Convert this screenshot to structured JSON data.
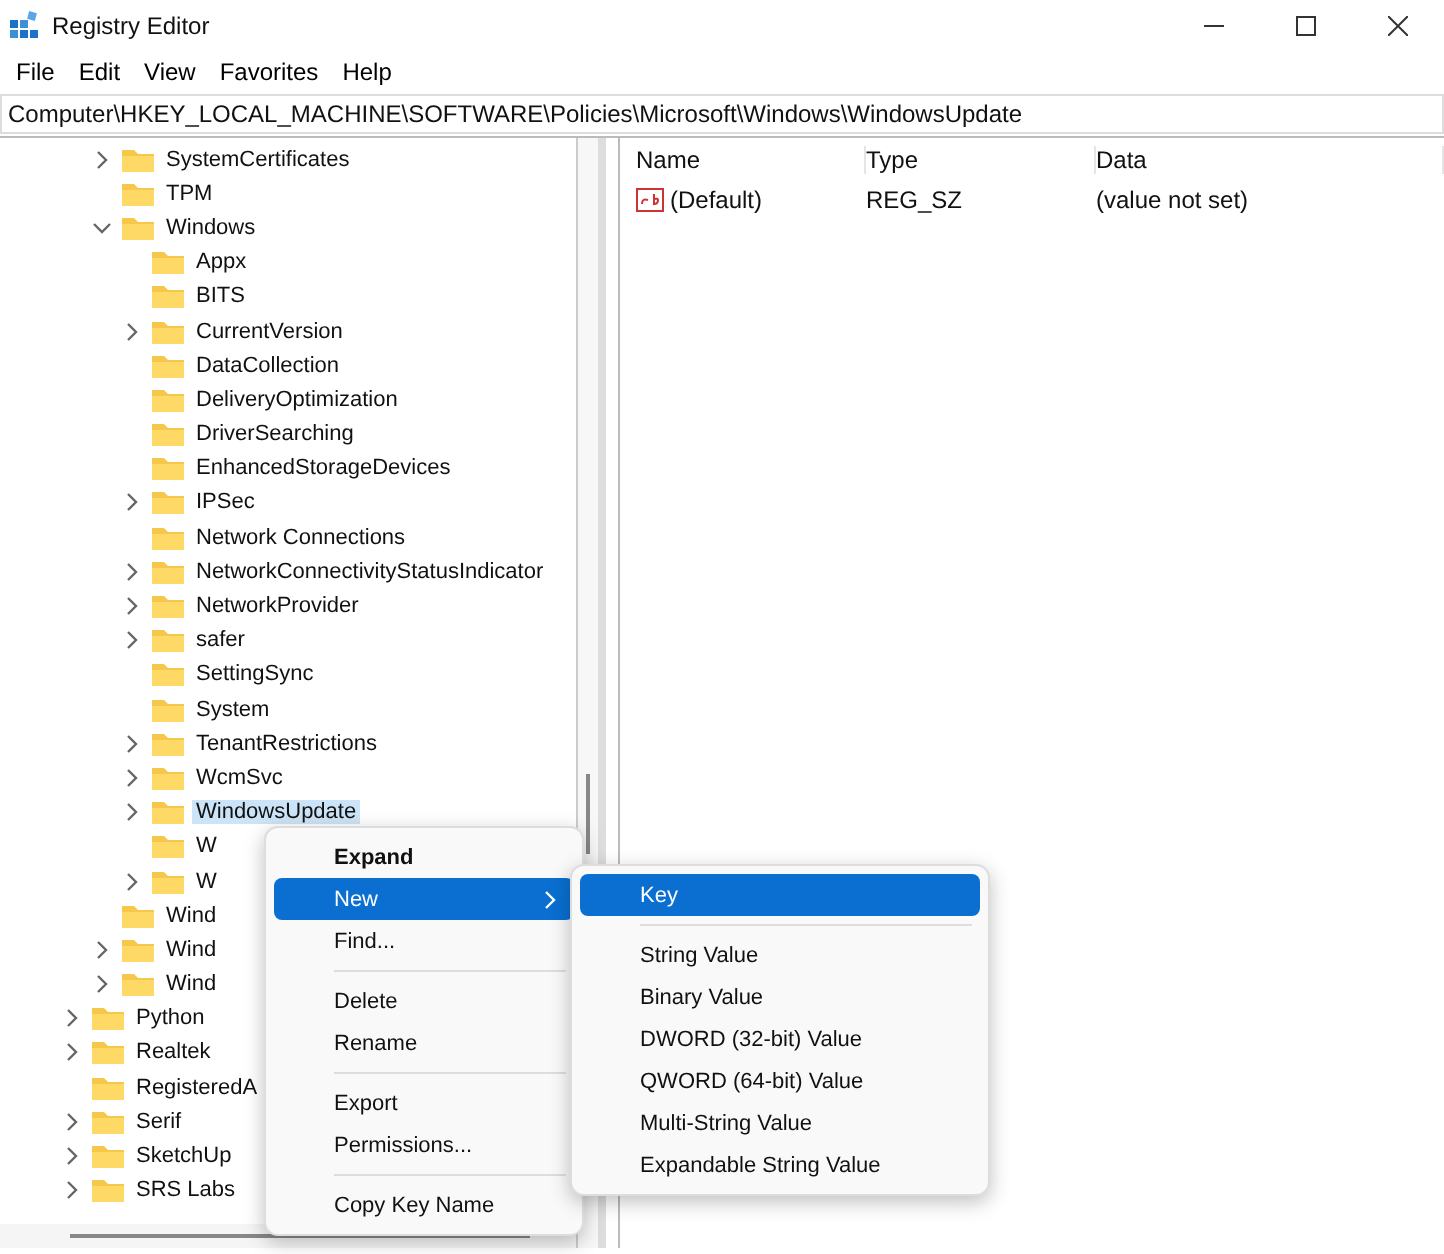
{
  "window": {
    "title": "Registry Editor"
  },
  "menu_bar": [
    "File",
    "Edit",
    "View",
    "Favorites",
    "Help"
  ],
  "address": "Computer\\HKEY_LOCAL_MACHINE\\SOFTWARE\\Policies\\Microsoft\\Windows\\WindowsUpdate",
  "tree": [
    {
      "label": "SystemCertificates",
      "expanded": false,
      "selected": false
    },
    {
      "label": "TPM",
      "selected": false
    },
    {
      "label": "Windows",
      "expanded": true,
      "selected": false,
      "children": [
        {
          "label": "Appx",
          "selected": false
        },
        {
          "label": "BITS",
          "selected": false
        },
        {
          "label": "CurrentVersion",
          "expanded": false,
          "selected": false
        },
        {
          "label": "DataCollection",
          "selected": false
        },
        {
          "label": "DeliveryOptimization",
          "selected": false
        },
        {
          "label": "DriverSearching",
          "selected": false
        },
        {
          "label": "EnhancedStorageDevices",
          "selected": false
        },
        {
          "label": "IPSec",
          "expanded": false,
          "selected": false
        },
        {
          "label": "Network Connections",
          "selected": false
        },
        {
          "label": "NetworkConnectivityStatusIndicator",
          "expanded": false,
          "selected": false
        },
        {
          "label": "NetworkProvider",
          "expanded": false,
          "selected": false
        },
        {
          "label": "safer",
          "expanded": false,
          "selected": false
        },
        {
          "label": "SettingSync",
          "selected": false
        },
        {
          "label": "System",
          "selected": false
        },
        {
          "label": "TenantRestrictions",
          "expanded": false,
          "selected": false
        },
        {
          "label": "WcmSvc",
          "expanded": false,
          "selected": false
        },
        {
          "label": "WindowsUpdate",
          "expanded": false,
          "selected": true
        },
        {
          "label": "W",
          "selected": false
        },
        {
          "label": "W",
          "expanded": false,
          "selected": false
        }
      ]
    },
    {
      "label": "Wind",
      "selected": false
    },
    {
      "label": "Wind",
      "expanded": false,
      "selected": false
    },
    {
      "label": "Wind",
      "expanded": false,
      "selected": false
    }
  ],
  "tree_root": [
    {
      "label": "Python",
      "expanded": false,
      "selected": false
    },
    {
      "label": "Realtek",
      "expanded": false,
      "selected": false
    },
    {
      "label": "RegisteredA",
      "selected": false
    },
    {
      "label": "Serif",
      "expanded": false,
      "selected": false
    },
    {
      "label": "SketchUp",
      "expanded": false,
      "selected": false
    },
    {
      "label": "SRS Labs",
      "expanded": false,
      "selected": false
    }
  ],
  "table": {
    "columns": [
      "Name",
      "Type",
      "Data"
    ],
    "rows": [
      {
        "name": "(Default)",
        "type": "REG_SZ",
        "data": "(value not set)"
      }
    ]
  },
  "context_menu": [
    {
      "kind": "item",
      "label": "Expand",
      "bold": true,
      "selected": false,
      "submenu": false
    },
    {
      "kind": "item",
      "label": "New",
      "bold": false,
      "selected": true,
      "submenu": true
    },
    {
      "kind": "item",
      "label": "Find...",
      "bold": false,
      "selected": false,
      "submenu": false
    },
    {
      "kind": "separator"
    },
    {
      "kind": "item",
      "label": "Delete",
      "bold": false,
      "selected": false,
      "submenu": false
    },
    {
      "kind": "item",
      "label": "Rename",
      "bold": false,
      "selected": false,
      "submenu": false
    },
    {
      "kind": "separator"
    },
    {
      "kind": "item",
      "label": "Export",
      "bold": false,
      "selected": false,
      "submenu": false
    },
    {
      "kind": "item",
      "label": "Permissions...",
      "bold": false,
      "selected": false,
      "submenu": false
    },
    {
      "kind": "separator"
    },
    {
      "kind": "item",
      "label": "Copy Key Name",
      "bold": false,
      "selected": false,
      "submenu": false
    }
  ],
  "submenu": [
    {
      "kind": "item",
      "label": "Key",
      "bold": false,
      "selected": true,
      "submenu": false
    },
    {
      "kind": "separator"
    },
    {
      "kind": "item",
      "label": "String Value",
      "bold": false,
      "selected": false,
      "submenu": false
    },
    {
      "kind": "item",
      "label": "Binary Value",
      "bold": false,
      "selected": false,
      "submenu": false
    },
    {
      "kind": "item",
      "label": "DWORD (32-bit) Value",
      "bold": false,
      "selected": false,
      "submenu": false
    },
    {
      "kind": "item",
      "label": "QWORD (64-bit) Value",
      "bold": false,
      "selected": false,
      "submenu": false
    },
    {
      "kind": "item",
      "label": "Multi-String Value",
      "bold": false,
      "selected": false,
      "submenu": false
    },
    {
      "kind": "item",
      "label": "Expandable String Value",
      "bold": false,
      "selected": false,
      "submenu": false
    }
  ]
}
